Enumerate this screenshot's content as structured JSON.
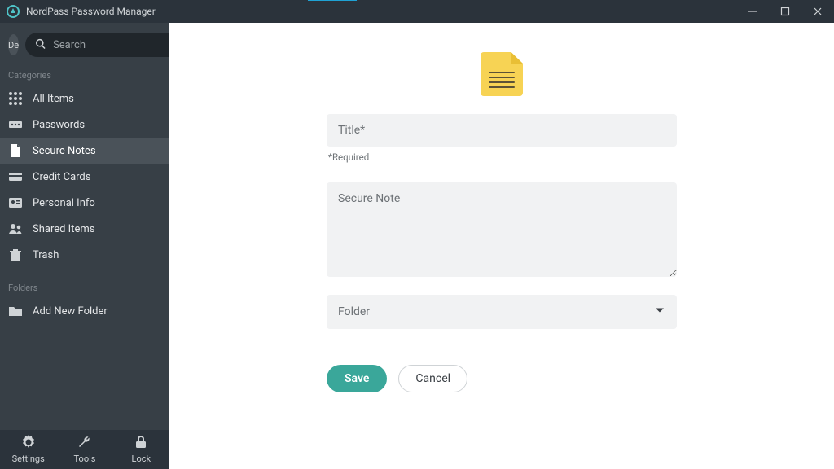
{
  "window": {
    "title": "NordPass Password Manager"
  },
  "sidebar": {
    "avatar": "De",
    "search_placeholder": "Search",
    "categories_label": "Categories",
    "folders_label": "Folders",
    "items": [
      {
        "label": "All Items"
      },
      {
        "label": "Passwords"
      },
      {
        "label": "Secure Notes"
      },
      {
        "label": "Credit Cards"
      },
      {
        "label": "Personal Info"
      },
      {
        "label": "Shared Items"
      },
      {
        "label": "Trash"
      }
    ],
    "add_folder_label": "Add New Folder",
    "bottom": {
      "settings": "Settings",
      "tools": "Tools",
      "lock": "Lock"
    }
  },
  "form": {
    "title_placeholder": "Title*",
    "required_hint": "*Required",
    "note_placeholder": "Secure Note",
    "folder_label": "Folder",
    "save": "Save",
    "cancel": "Cancel"
  }
}
